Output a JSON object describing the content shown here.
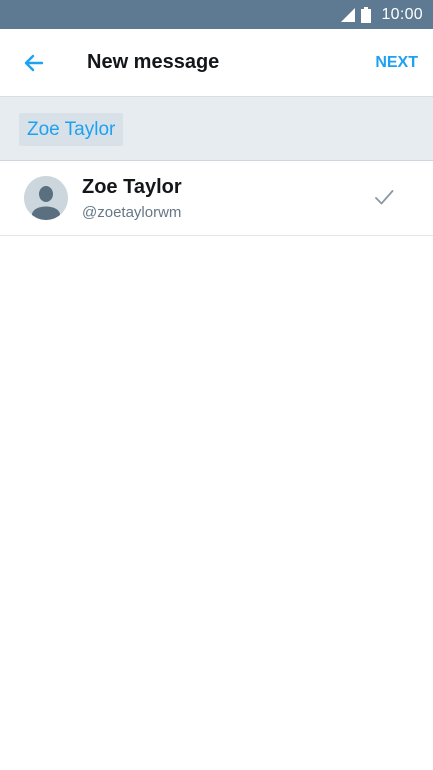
{
  "status_bar": {
    "time": "10:00",
    "icons": [
      "signal-icon",
      "battery-icon"
    ]
  },
  "header": {
    "back_icon": "arrow-left-icon",
    "title": "New message",
    "next_label": "NEXT"
  },
  "recipients": {
    "chips": [
      {
        "label": "Zoe Taylor"
      }
    ]
  },
  "results": [
    {
      "name": "Zoe Taylor",
      "handle": "@zoetaylorwm",
      "avatar_icon": "default-avatar-icon",
      "selected": true,
      "status_icon": "check-icon"
    }
  ],
  "colors": {
    "status_bar": "#5e7a92",
    "accent": "#1da1f2",
    "recipients_bg": "#e6ecf0",
    "chip_bg": "#d8e1e8",
    "text_primary": "#14171a",
    "text_secondary": "#657786"
  }
}
